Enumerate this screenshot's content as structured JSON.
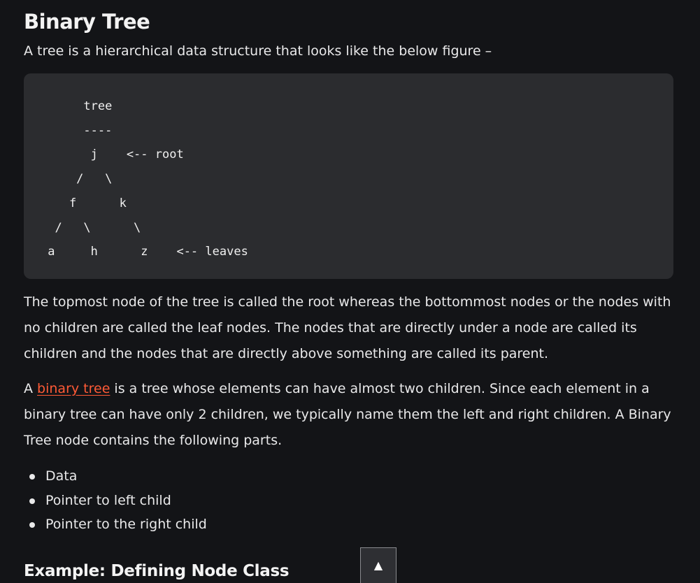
{
  "article": {
    "title": "Binary Tree",
    "intro": "A tree is a  hierarchical data structure that looks like the below figure –",
    "code": "      tree\n      ----\n       j    <-- root\n     /   \\\n    f      k\n  /   \\      \\\n a     h      z    <-- leaves",
    "paragraph1": "The topmost node of the tree is called the root whereas the bottommost nodes or the nodes with no children are called the leaf nodes. The nodes that are directly under a node are called its children and the nodes that are directly above something are called its parent.",
    "paragraph2": {
      "prefix": "A ",
      "link_text": "binary tree",
      "suffix": " is a tree whose elements can have almost two children. Since each element in a binary tree can have only 2 children, we typically name them the left and right children. A Binary Tree node contains the following parts."
    },
    "list_items": [
      "Data",
      "Pointer to left child",
      "Pointer to the right child"
    ],
    "subheading": "Example: Defining Node Class"
  },
  "scroll_top": {
    "icon": "up-triangle-icon",
    "glyph": "▲"
  },
  "colors": {
    "background": "#131417",
    "code_background": "#2b2c2f",
    "text": "#e9e9ea",
    "link": "#ff5a36"
  }
}
